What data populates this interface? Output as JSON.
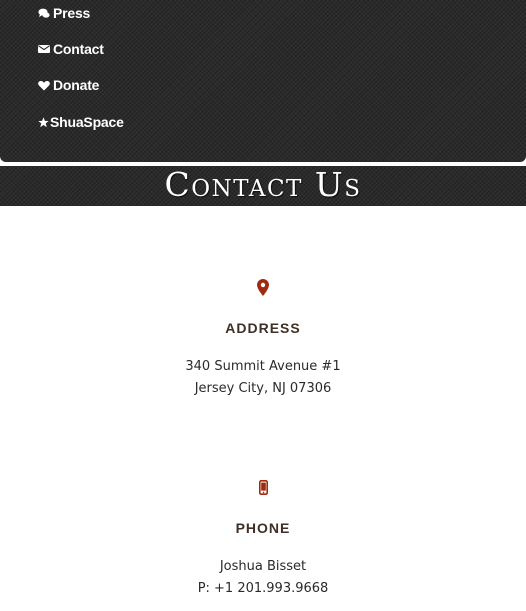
{
  "nav": {
    "items": [
      {
        "label": "Press",
        "icon": "comments-icon"
      },
      {
        "label": "Contact",
        "icon": "envelope-icon"
      },
      {
        "label": "Donate",
        "icon": "heart-icon"
      },
      {
        "label": "ShuaSpace",
        "icon": "star-icon"
      }
    ]
  },
  "page": {
    "title": "Contact Us"
  },
  "address": {
    "icon": "map-marker-icon",
    "heading": "ADDRESS",
    "line1": "340 Summit Avenue #1",
    "line2": "Jersey City, NJ 07306"
  },
  "phone": {
    "icon": "mobile-phone-icon",
    "heading": "PHONE",
    "name": "Joshua Bisset",
    "number": "P: +1 201.993.9668"
  },
  "colors": {
    "accent": "#9e2a0f",
    "heading_text": "#3e3026",
    "panel_bg": "#2b2b2b"
  }
}
